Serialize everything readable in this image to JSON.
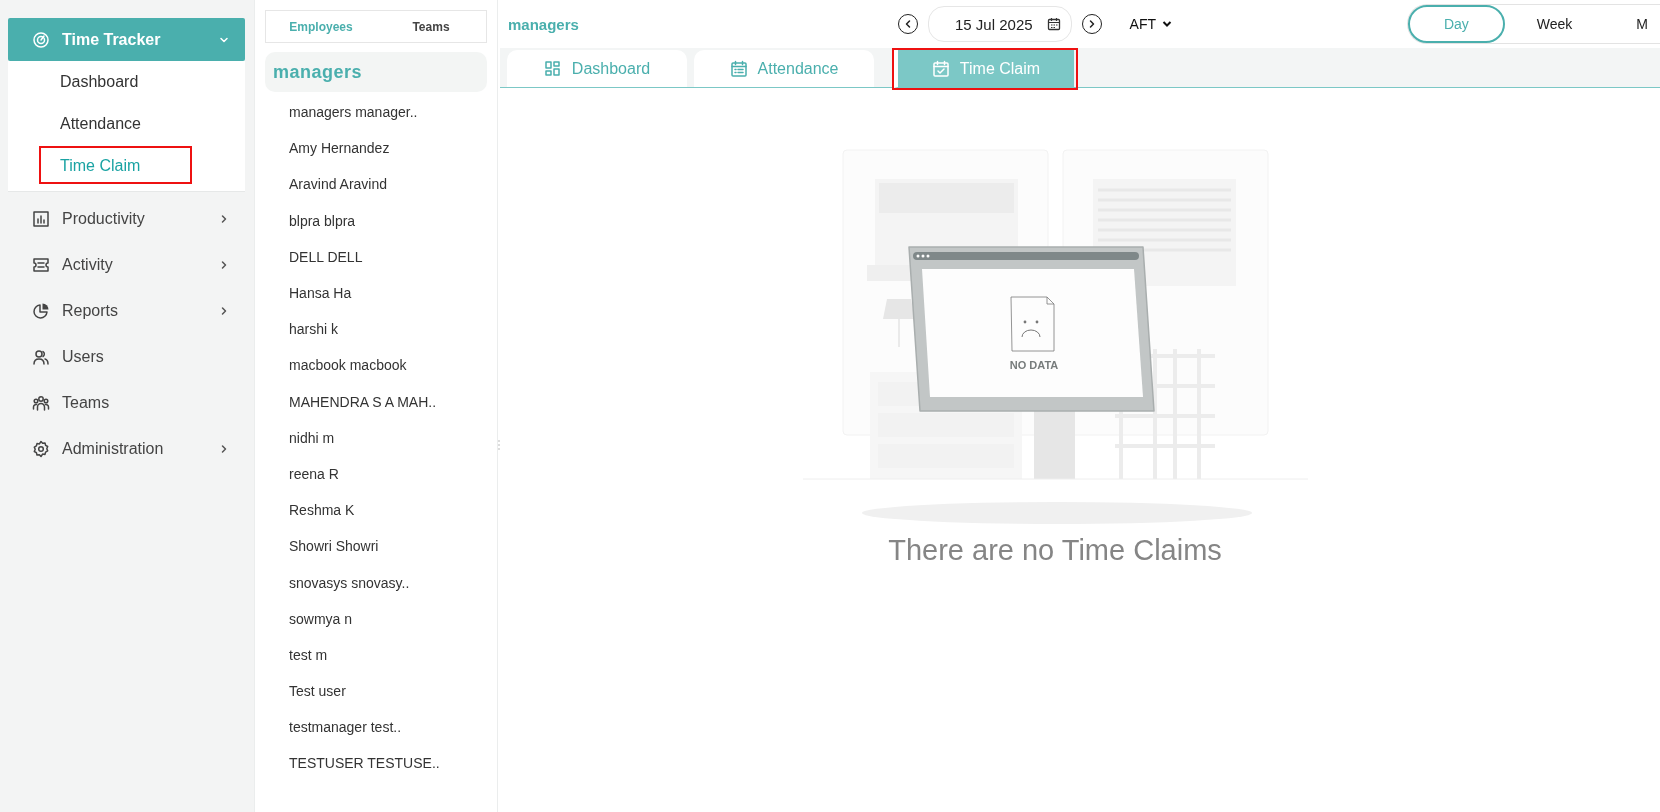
{
  "sidebar": {
    "items": [
      {
        "label": "Time Tracker",
        "kind": "group",
        "expanded": true,
        "children": [
          {
            "label": "Dashboard",
            "selected": false,
            "highlighted": false
          },
          {
            "label": "Attendance",
            "selected": false,
            "highlighted": false
          },
          {
            "label": "Time Claim",
            "selected": true,
            "highlighted": true
          }
        ]
      },
      {
        "label": "Productivity",
        "kind": "group",
        "expanded": false
      },
      {
        "label": "Activity",
        "kind": "group",
        "expanded": false
      },
      {
        "label": "Reports",
        "kind": "group",
        "expanded": false
      },
      {
        "label": "Users",
        "kind": "link"
      },
      {
        "label": "Teams",
        "kind": "link"
      },
      {
        "label": "Administration",
        "kind": "group",
        "expanded": false
      }
    ]
  },
  "people_panel": {
    "tabs": [
      {
        "label": "Employees",
        "selected": true
      },
      {
        "label": "Teams",
        "selected": false
      }
    ],
    "group": "managers",
    "members": [
      "managers manager..",
      "Amy Hernandez",
      "Aravind Aravind",
      "blpra blpra",
      "DELL DELL",
      "Hansa Ha",
      "harshi k",
      "macbook macbook",
      "MAHENDRA S A MAH..",
      "nidhi m",
      "reena R",
      "Reshma K",
      "Showri Showri",
      "snovasys snovasy..",
      "sowmya n",
      "test m",
      "Test user",
      "testmanager test..",
      "TESTUSER TESTUSE.."
    ]
  },
  "toolbar": {
    "title": "managers",
    "date": "15 Jul 2025",
    "timezone": "AFT",
    "periods": [
      {
        "label": "Day",
        "selected": true
      },
      {
        "label": "Week",
        "selected": false
      },
      {
        "label": "M",
        "selected": false
      }
    ]
  },
  "tabs": [
    {
      "label": "Dashboard",
      "selected": false,
      "highlighted": false
    },
    {
      "label": "Attendance",
      "selected": false,
      "highlighted": false
    },
    {
      "label": "Time Claim",
      "selected": true,
      "highlighted": true
    }
  ],
  "empty_state": {
    "illustration_label": "NO DATA",
    "message": "There are no Time Claims"
  }
}
